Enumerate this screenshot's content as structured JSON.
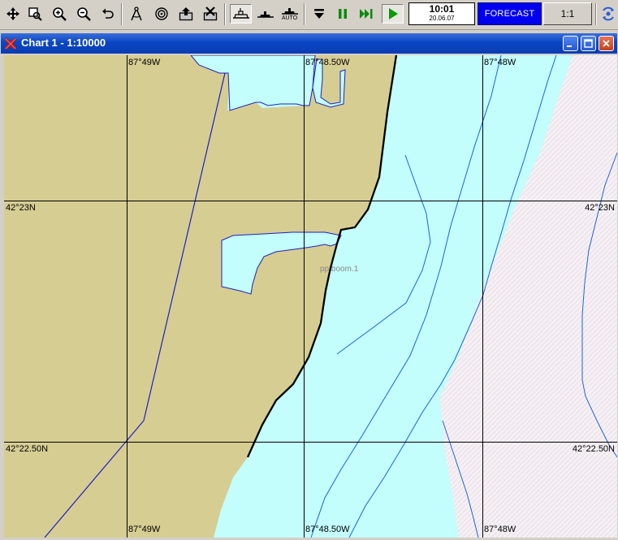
{
  "toolbar": {
    "buttons": [
      {
        "id": "pan",
        "icon": "pan-arrows-icon"
      },
      {
        "id": "zoom-window",
        "icon": "zoom-window-icon"
      },
      {
        "id": "zoom-in",
        "icon": "zoom-in-icon"
      },
      {
        "id": "zoom-out",
        "icon": "zoom-out-icon"
      },
      {
        "id": "undo-view",
        "icon": "undo-icon"
      },
      {
        "id": "compass",
        "icon": "compass-icon"
      },
      {
        "id": "target",
        "icon": "target-icon"
      },
      {
        "id": "export",
        "icon": "export-icon"
      },
      {
        "id": "delete",
        "icon": "delete-icon"
      },
      {
        "id": "ship-mode",
        "icon": "ship-icon",
        "pressed": true
      },
      {
        "id": "vessel-small",
        "icon": "small-vessel-icon"
      },
      {
        "id": "auto-mode",
        "icon": "auto-ship-icon",
        "label": "AUTO"
      },
      {
        "id": "stop",
        "icon": "stop-icon"
      },
      {
        "id": "pause",
        "icon": "pause-icon"
      },
      {
        "id": "fast-forward",
        "icon": "fast-forward-icon"
      },
      {
        "id": "play",
        "icon": "play-icon"
      },
      {
        "id": "settings",
        "icon": "settings-icon"
      }
    ],
    "clock_time": "10:01",
    "clock_date": "20.06.07",
    "forecast_label": "FORECAST",
    "scale_label": "1:1"
  },
  "window": {
    "title": "Chart 1 - 1:10000",
    "controls": [
      "minimize",
      "maximize",
      "close"
    ]
  },
  "chart": {
    "longitude_labels": [
      "87°49W",
      "87°48.50W",
      "87°48W"
    ],
    "latitude_labels": [
      "42°23N",
      "42°22.50N"
    ],
    "feature_label": "pp boom.1",
    "colors": {
      "land": "#d6cd93",
      "water": "#c3fdfc",
      "deep_water": "#f6f0f4",
      "grid": "#000000",
      "depth_contour": "#1c63e0",
      "shoreline": "#000000",
      "boundary": "#2020c0"
    }
  }
}
